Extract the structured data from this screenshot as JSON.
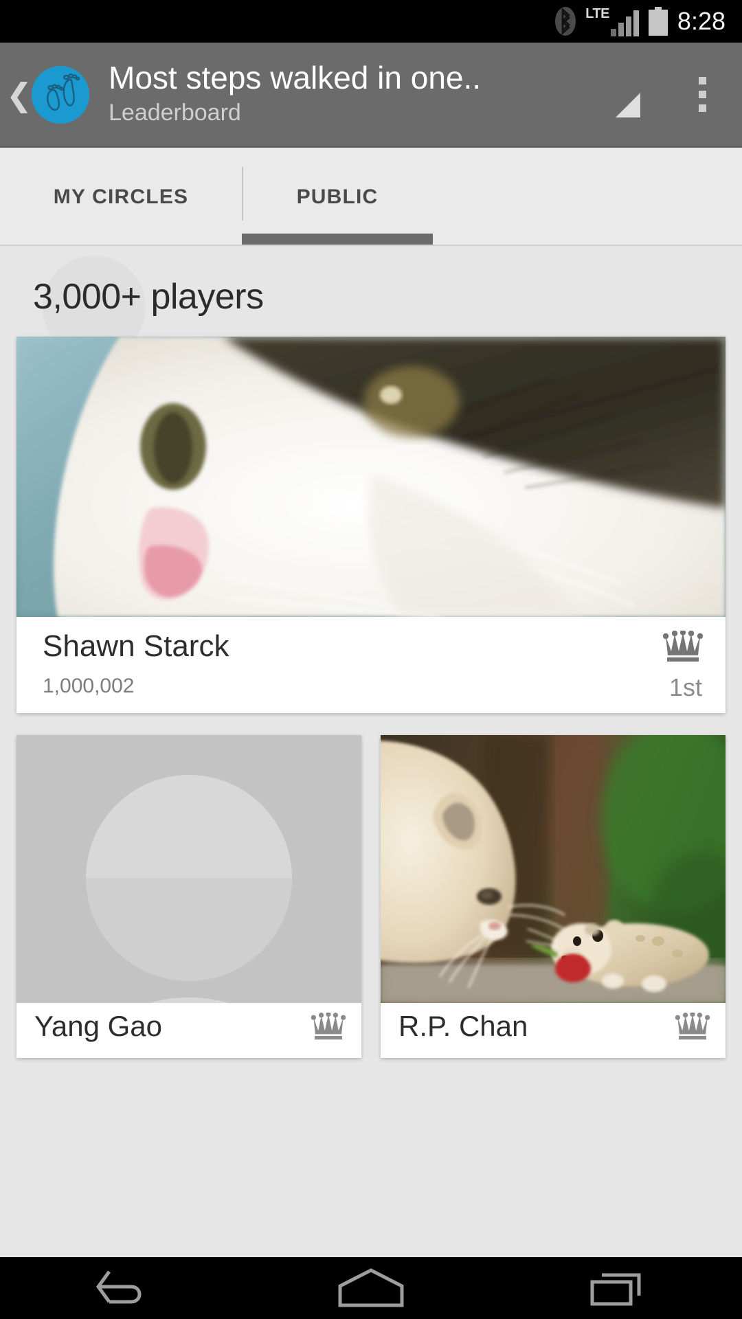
{
  "status_bar": {
    "bluetooth_icon": "bluetooth-icon",
    "network_label": "LTE",
    "signal_icon": "signal-bars-icon",
    "battery_icon": "battery-full-icon",
    "time": "8:28"
  },
  "action_bar": {
    "back_icon": "back-chevron-icon",
    "app_icon": "footprints-app-icon",
    "title": "Most steps walked in one..",
    "subtitle": "Leaderboard",
    "corner_indicator_icon": "corner-triangle-icon",
    "overflow_icon": "overflow-menu-icon"
  },
  "tabs": [
    {
      "label": "MY CIRCLES",
      "selected": false
    },
    {
      "label": "PUBLIC",
      "selected": true
    }
  ],
  "content": {
    "players_count": "3,000+ players",
    "entries": [
      {
        "name": "Shawn Starck",
        "score": "1,000,002",
        "rank": "1st",
        "badge_icon": "crown-icon",
        "avatar": "cat-face-photo"
      },
      {
        "name": "Yang Gao",
        "score": "",
        "rank": "",
        "badge_icon": "crown-icon",
        "avatar": "default-person-placeholder"
      },
      {
        "name": "R.P. Chan",
        "score": "",
        "rank": "",
        "badge_icon": "crown-icon",
        "avatar": "cat-and-hamster-photo"
      }
    ]
  },
  "nav_bar": {
    "back_icon": "nav-back-icon",
    "home_icon": "nav-home-icon",
    "recents_icon": "nav-recents-icon"
  },
  "colors": {
    "action_bar_bg": "#6b6b6b",
    "app_icon_blue": "#1b9ad2",
    "tab_indicator": "#6b6b6b",
    "page_bg": "#e6e6e6",
    "card_bg": "#ffffff"
  }
}
